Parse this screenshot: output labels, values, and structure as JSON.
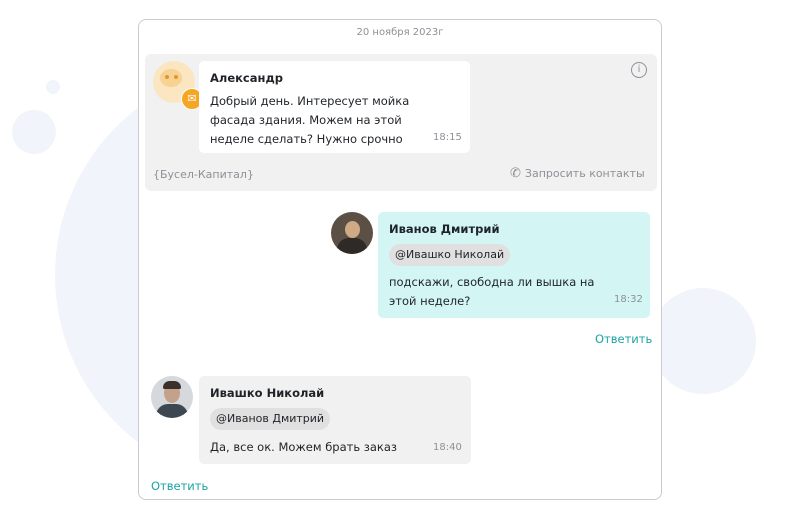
{
  "chat": {
    "date": "20 ноября 2023г",
    "order": {
      "author": "Александр",
      "text": "Добрый день. Интересует мойка фасада здания. Можем на этой неделе сделать? Нужно срочно",
      "time": "18:15",
      "company": "{Бусел-Капитал}",
      "request_contacts_label": "Запросить контакты"
    },
    "messages": [
      {
        "author": "Иванов Дмитрий",
        "mention": "@Ивашко Николай",
        "text": "подскажи, свободна ли вышка на этой неделе?",
        "time": "18:32",
        "reply_label": "Ответить"
      },
      {
        "author": "Ивашко Николай",
        "mention": "@Иванов Дмитрий",
        "text": "Да, все ок. Можем брать заказ",
        "time": "18:40",
        "reply_label": "Ответить"
      }
    ]
  },
  "colors": {
    "accent": "#1aa3a3",
    "own_bubble": "#d3f6f5",
    "grey_bubble": "#f1f1f1",
    "badge_orange": "#f5a623"
  },
  "icons": [
    "info-icon",
    "phone-icon",
    "client-chat-badge-icon"
  ]
}
